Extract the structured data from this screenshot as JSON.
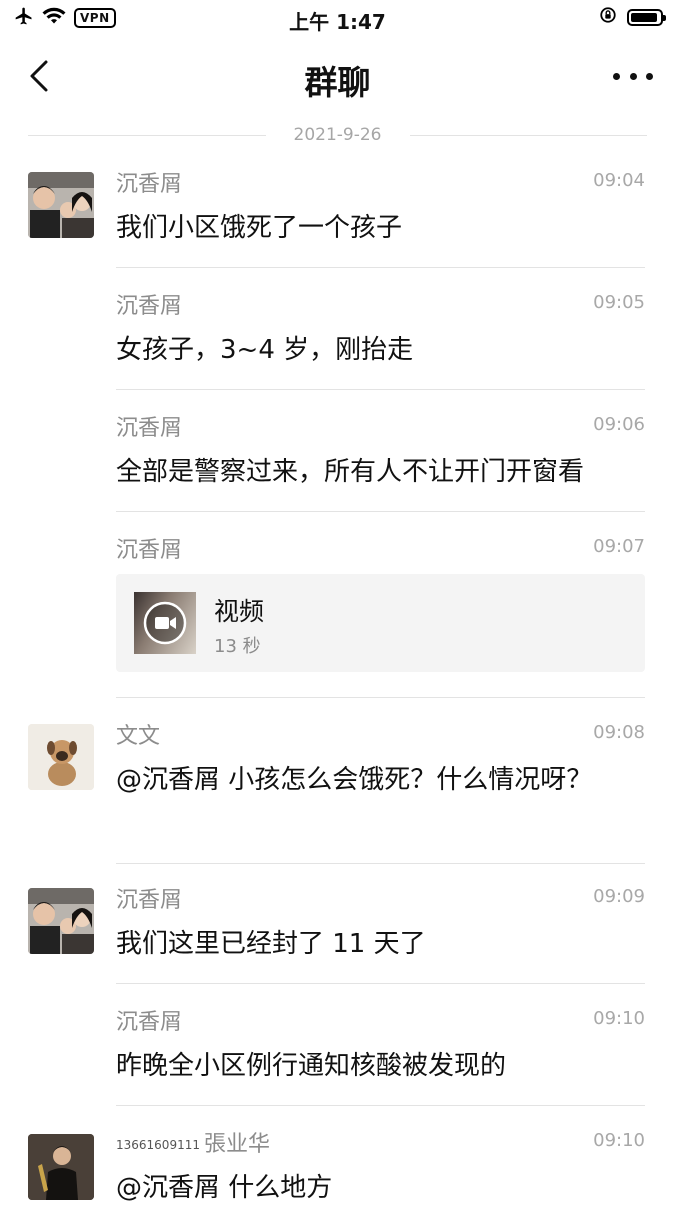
{
  "status_bar": {
    "vpn_label": "VPN",
    "time": "上午 1:47"
  },
  "nav": {
    "title": "群聊"
  },
  "date_divider": "2021-9-26",
  "messages": [
    {
      "sender": "沉香屑",
      "time": "09:04",
      "text": "我们小区饿死了一个孩子"
    },
    {
      "sender": "沉香屑",
      "time": "09:05",
      "text": "女孩子，3~4 岁，刚抬走"
    },
    {
      "sender": "沉香屑",
      "time": "09:06",
      "text": "全部是警察过来，所有人不让开门开窗看"
    },
    {
      "sender": "沉香屑",
      "time": "09:07",
      "video": {
        "title": "视频",
        "duration": "13 秒"
      }
    },
    {
      "sender": "文文",
      "time": "09:08",
      "text": "@沉香屑  小孩怎么会饿死？什么情况呀？"
    },
    {
      "sender": "沉香屑",
      "time": "09:09",
      "text": "我们这里已经封了 11 天了"
    },
    {
      "sender": "沉香屑",
      "time": "09:10",
      "text": "昨晚全小区例行通知核酸被发现的"
    },
    {
      "sender_prefix": "13661609111",
      "sender": "張业华",
      "time": "09:10",
      "text": "@沉香屑 什么地方"
    }
  ],
  "colors": {
    "background": "#ffffff",
    "separator": "#e3e3e3",
    "meta_text": "#8c8c8c",
    "video_card": "#f4f4f4"
  }
}
